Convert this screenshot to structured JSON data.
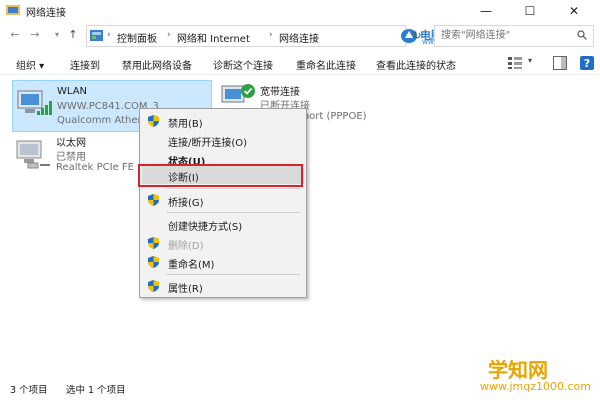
{
  "window": {
    "title": "网络连接",
    "minimize": "—",
    "maximize": "☐",
    "close": "✕"
  },
  "address": {
    "crumbs": [
      "控制面板",
      "网络和 Internet",
      "网络连接"
    ],
    "search_placeholder": "搜索\"网络连接\""
  },
  "watermark": {
    "main": "电脑百事网",
    "sub": "WWW.PC841.COM"
  },
  "toolbar": {
    "organize": "组织 ▾",
    "connect_to": "连接到",
    "disable_device": "禁用此网络设备",
    "diagnose": "诊断这个连接",
    "rename": "重命名此连接",
    "view_status": "查看此连接的状态"
  },
  "connections": [
    {
      "name": "WLAN",
      "status": "WWW.PC841.COM_3",
      "device": "Qualcomm Athero"
    },
    {
      "name": "宽带连接",
      "status": "已断开连接",
      "device": "WAN Miniport (PPPOE)",
      "device_visible": "iport (PPPOE)"
    },
    {
      "name": "以太网",
      "status": "已禁用",
      "device": "Realtek PCIe FE"
    }
  ],
  "context_menu": {
    "items": [
      {
        "label": "禁用(B)",
        "shield": true
      },
      {
        "label": "连接/断开连接(O)",
        "shield": false
      },
      {
        "label": "状态(U)",
        "shield": false,
        "bold": true
      },
      {
        "label": "诊断(I)",
        "shield": false,
        "highlight": true
      },
      {
        "label": "桥接(G)",
        "shield": true
      },
      {
        "label": "创建快捷方式(S)",
        "shield": false
      },
      {
        "label": "删除(D)",
        "shield": true,
        "disabled": true
      },
      {
        "label": "重命名(M)",
        "shield": true
      },
      {
        "label": "属性(R)",
        "shield": true
      }
    ]
  },
  "statusbar": {
    "count": "3 个项目",
    "selected": "选中 1 个项目"
  },
  "site_watermark": {
    "name": "学知网",
    "url": "www.jmqz1000.com"
  },
  "colors": {
    "selection": "#cce8ff",
    "highlight_box": "#d8232a",
    "accent_blue": "#2b7fd0",
    "site_gold": "#e8a400"
  }
}
